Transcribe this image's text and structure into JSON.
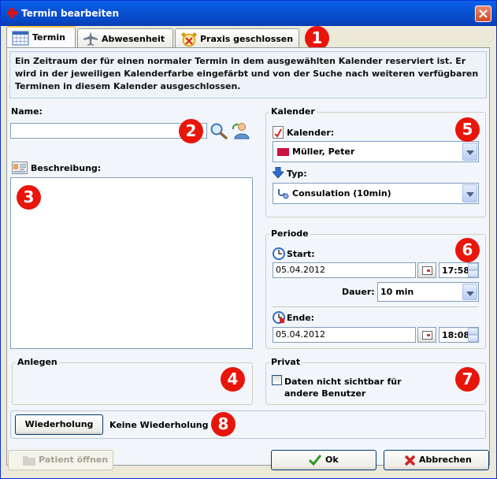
{
  "window": {
    "title": "Termin bearbeiten"
  },
  "tabs": [
    {
      "label": "Termin",
      "icon": "calendar-icon"
    },
    {
      "label": "Abwesenheit",
      "icon": "airplane-icon"
    },
    {
      "label": "Praxis geschlossen",
      "icon": "alarm-clock-closed-icon"
    }
  ],
  "description": "Ein Zeitraum der für einen normaler Termin in dem ausgewählten Kalender reserviert ist. Er wird in der jeweiligen Kalenderfarbe eingefärbt und von der Suche nach weiteren verfügbaren Terminen in diesem Kalender ausgeschlossen.",
  "name_field": {
    "label": "Name:",
    "value": ""
  },
  "beschreibung": {
    "label": "Beschreibung:",
    "value": ""
  },
  "kalender_group": {
    "title": "Kalender",
    "kalender_label": "Kalender:",
    "kalender_value": "Müller, Peter",
    "kalender_color": "#CC1144",
    "typ_label": "Typ:",
    "typ_value": "Consulation  (10min)"
  },
  "periode_group": {
    "title": "Periode",
    "start_label": "Start:",
    "start_date": "05.04.2012",
    "start_time": "17:58",
    "dauer_label": "Dauer:",
    "dauer_value": "10 min",
    "ende_label": "Ende:",
    "ende_date": "05.04.2012",
    "ende_time": "18:08"
  },
  "anlegen_group": {
    "title": "Anlegen"
  },
  "privat_group": {
    "title": "Privat",
    "checkbox_label_line1": "Daten nicht sichtbar für",
    "checkbox_label_line2": "andere Benutzer"
  },
  "wiederholung": {
    "button_label": "Wiederholung",
    "status": "Keine Wiederholung"
  },
  "footer": {
    "patient_button": "Patient öffnen",
    "ok_button": "Ok",
    "cancel_button": "Abbrechen"
  },
  "badges": [
    "1",
    "2",
    "3",
    "4",
    "5",
    "6",
    "7",
    "8"
  ],
  "colors": {
    "badge": "#E8150B",
    "titlebar": "#0A5FE8"
  }
}
